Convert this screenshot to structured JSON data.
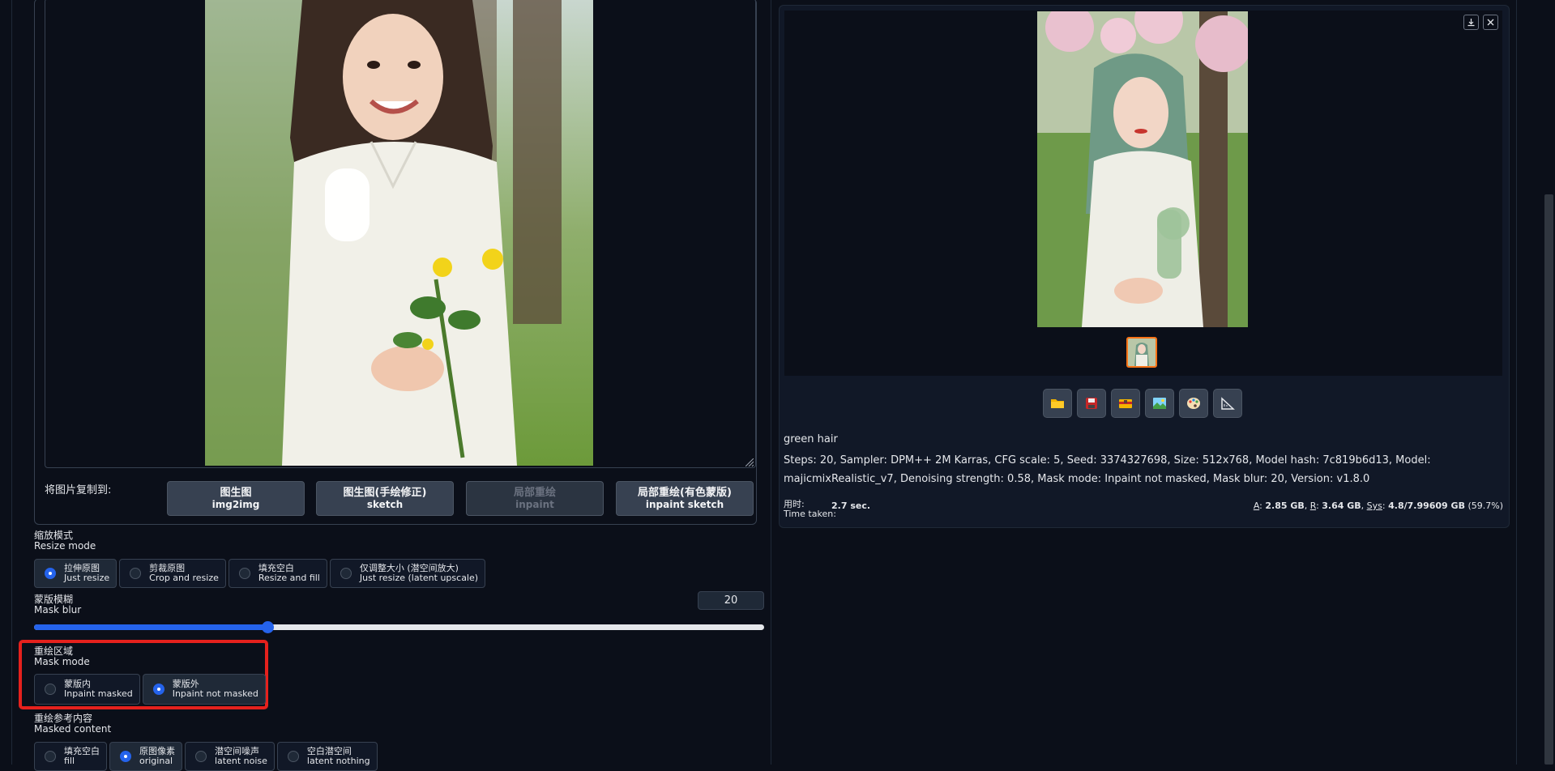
{
  "copy_to": {
    "label": "将图片复制到:",
    "buttons": [
      {
        "zh": "图生图",
        "en": "img2img",
        "enabled": true
      },
      {
        "zh": "图生图(手绘修正)",
        "en": "sketch",
        "enabled": true
      },
      {
        "zh": "局部重绘",
        "en": "inpaint",
        "enabled": false
      },
      {
        "zh": "局部重绘(有色蒙版)",
        "en": "inpaint sketch",
        "enabled": true
      }
    ]
  },
  "resize_mode": {
    "label_zh": "缩放模式",
    "label_en": "Resize mode",
    "options": [
      {
        "zh": "拉伸原图",
        "en": "Just resize",
        "selected": true
      },
      {
        "zh": "剪裁原图",
        "en": "Crop and resize",
        "selected": false
      },
      {
        "zh": "填充空白",
        "en": "Resize and fill",
        "selected": false
      },
      {
        "zh": "仅调整大小 (潜空间放大)",
        "en": "Just resize (latent upscale)",
        "selected": false
      }
    ]
  },
  "mask_blur": {
    "label_zh": "蒙版模糊",
    "label_en": "Mask blur",
    "value": "20",
    "slider_fraction": 0.32
  },
  "mask_mode": {
    "label_zh": "重绘区域",
    "label_en": "Mask mode",
    "options": [
      {
        "zh": "蒙版内",
        "en": "Inpaint masked",
        "selected": false
      },
      {
        "zh": "蒙版外",
        "en": "Inpaint not masked",
        "selected": true
      }
    ],
    "highlight_color": "#e5211d"
  },
  "masked_content": {
    "label_zh": "重绘参考内容",
    "label_en": "Masked content",
    "options": [
      {
        "zh": "填充空白",
        "en": "fill",
        "selected": false
      },
      {
        "zh": "原图像素",
        "en": "original",
        "selected": true
      },
      {
        "zh": "潜空间噪声",
        "en": "latent noise",
        "selected": false
      },
      {
        "zh": "空白潜空间",
        "en": "latent nothing",
        "selected": false
      }
    ]
  },
  "output": {
    "prompt": "green hair",
    "params": "Steps: 20, Sampler: DPM++ 2M Karras, CFG scale: 5, Seed: 3374327698, Size: 512x768, Model hash: 7c819b6d13, Model: majicmixRealistic_v7, Denoising strength: 0.58, Mask mode: Inpaint not masked, Mask blur: 20, Version: v1.8.0",
    "time_label_zh": "用时:",
    "time_label_en": "Time taken:",
    "time_value": "2.7 sec.",
    "memory": {
      "a_key": "A",
      "a_val": "2.85 GB",
      "r_key": "R",
      "r_val": "3.64 GB",
      "sys_key": "Sys",
      "sys_val": "4.8/7.99609 GB",
      "pct": "(59.7%)"
    },
    "toolbar_icons": [
      "folder-icon",
      "save-icon",
      "zip-icon",
      "image-icon",
      "palette-icon",
      "ruler-icon"
    ]
  },
  "colors": {
    "accent": "#2563eb",
    "thumbnail_border": "#f97316",
    "background": "#0b0f19"
  }
}
